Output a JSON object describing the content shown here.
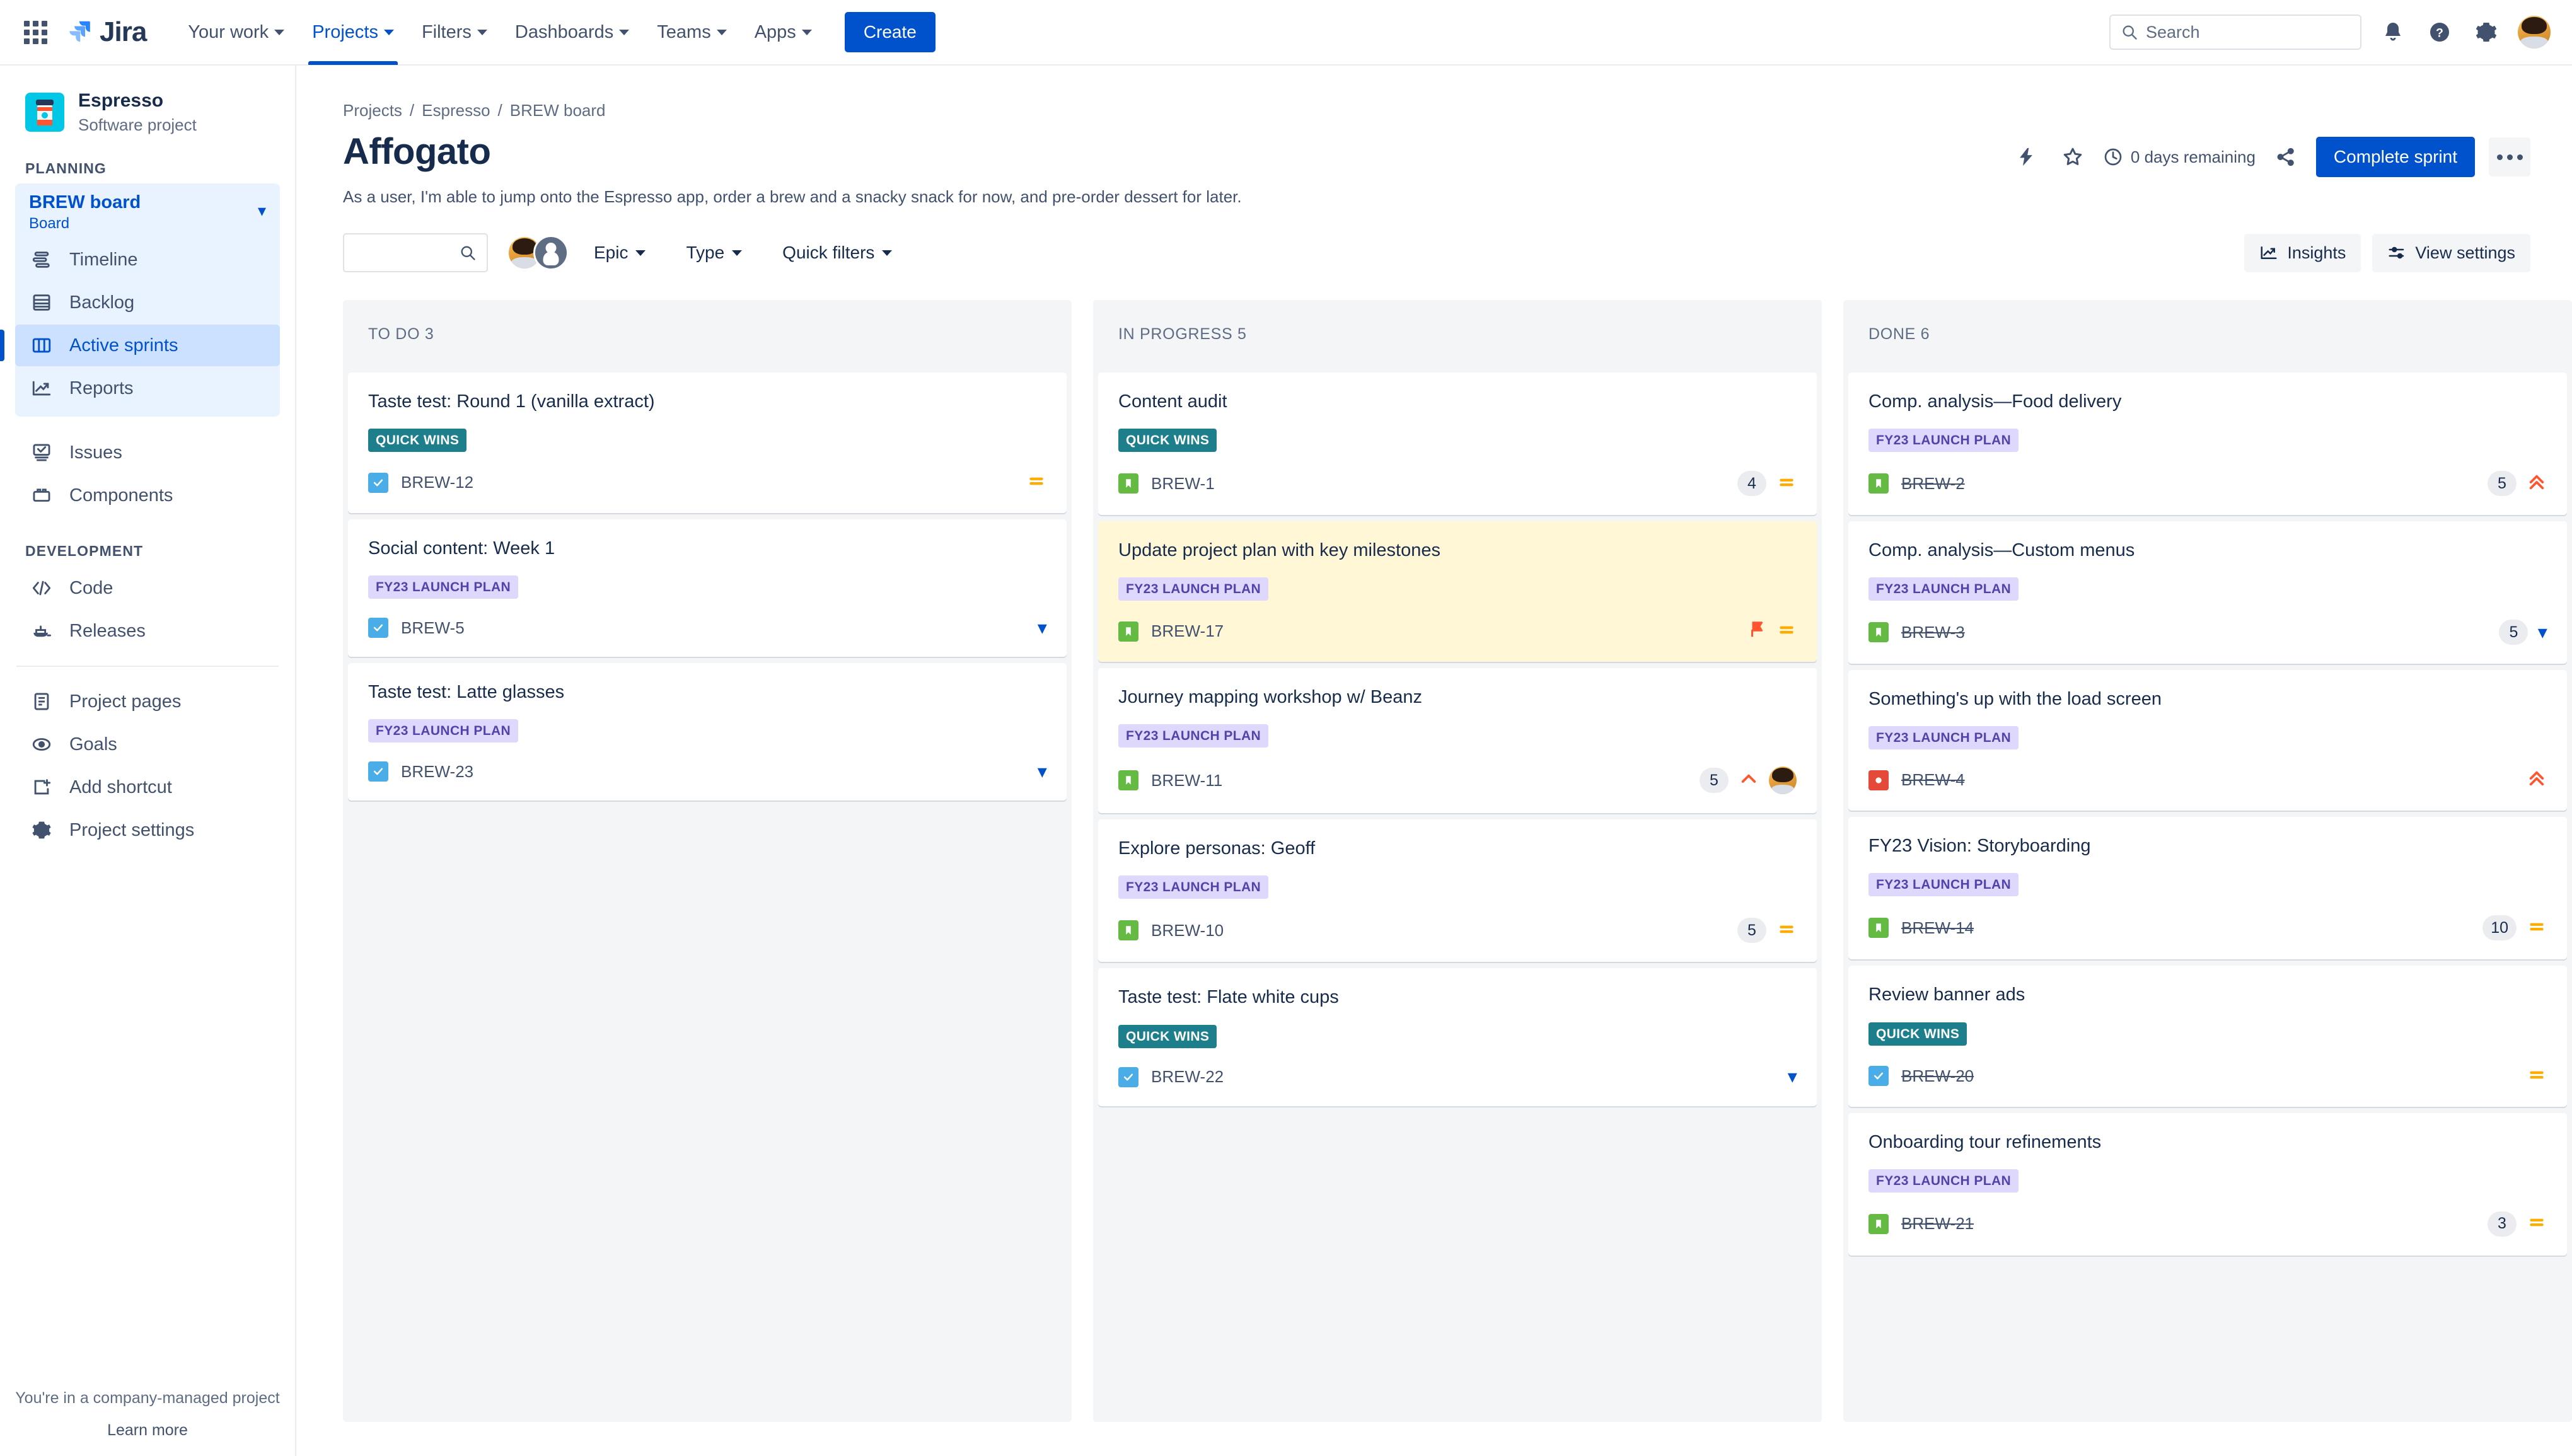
{
  "topnav": {
    "apps_icon": "apps-grid-icon",
    "brand": "Jira",
    "items": [
      {
        "label": "Your work",
        "icon": "chevron-down-icon",
        "active": false
      },
      {
        "label": "Projects",
        "icon": "chevron-down-icon",
        "active": true
      },
      {
        "label": "Filters",
        "icon": "chevron-down-icon",
        "active": false
      },
      {
        "label": "Dashboards",
        "icon": "chevron-down-icon",
        "active": false
      },
      {
        "label": "Teams",
        "icon": "chevron-down-icon",
        "active": false
      },
      {
        "label": "Apps",
        "icon": "chevron-down-icon",
        "active": false
      }
    ],
    "create_label": "Create",
    "search_placeholder": "Search",
    "search_value": "",
    "icons": [
      "search-icon",
      "notifications-bell-icon",
      "help-question-icon",
      "settings-gear-icon",
      "user-avatar"
    ]
  },
  "sidebar": {
    "project_name": "Espresso",
    "project_type": "Software project",
    "project_icon": "coffee-cup-icon",
    "planning_label": "PLANNING",
    "board_name": "BREW board",
    "board_sub": "Board",
    "planning_items": [
      {
        "label": "Timeline",
        "icon": "timeline-icon",
        "selected": false
      },
      {
        "label": "Backlog",
        "icon": "backlog-icon",
        "selected": false
      },
      {
        "label": "Active sprints",
        "icon": "board-columns-icon",
        "selected": true
      },
      {
        "label": "Reports",
        "icon": "reports-chart-icon",
        "selected": false
      }
    ],
    "other_items": [
      {
        "label": "Issues",
        "icon": "issues-icon",
        "selected": false
      },
      {
        "label": "Components",
        "icon": "components-icon",
        "selected": false
      }
    ],
    "development_label": "DEVELOPMENT",
    "development_items": [
      {
        "label": "Code",
        "icon": "code-brackets-icon",
        "selected": false
      },
      {
        "label": "Releases",
        "icon": "releases-ship-icon",
        "selected": false
      }
    ],
    "footer_items": [
      {
        "label": "Project pages",
        "icon": "page-document-icon",
        "selected": false
      },
      {
        "label": "Goals",
        "icon": "goals-eye-icon",
        "selected": false
      },
      {
        "label": "Add shortcut",
        "icon": "add-shortcut-icon",
        "selected": false
      },
      {
        "label": "Project settings",
        "icon": "settings-gear-icon",
        "selected": false
      }
    ],
    "footer_note": "You're in a company-managed project",
    "footer_link": "Learn more"
  },
  "header": {
    "breadcrumbs": [
      "Projects",
      "Espresso",
      "BREW board"
    ],
    "title": "Affogato",
    "sprint_goal": "As a user, I'm able to jump onto the Espresso app, order a brew and a snacky snack for now, and pre-order dessert for later.",
    "days_remaining": "0 days remaining",
    "complete_sprint_label": "Complete sprint",
    "action_icons": [
      "lightning-bolt-icon",
      "star-outline-icon",
      "clock-icon",
      "share-icon",
      "more-actions-icon"
    ]
  },
  "toolbar": {
    "search_value": "",
    "search_placeholder": "",
    "search_icon": "search-icon",
    "avatars": [
      "user-avatar",
      "unassigned-avatar"
    ],
    "filters": [
      {
        "label": "Epic",
        "icon": "chevron-down-icon"
      },
      {
        "label": "Type",
        "icon": "chevron-down-icon"
      },
      {
        "label": "Quick filters",
        "icon": "chevron-down-icon"
      }
    ],
    "insights_label": "Insights",
    "insights_icon": "insights-chart-icon",
    "view_settings_label": "View settings",
    "view_settings_icon": "sliders-icon"
  },
  "board": {
    "columns": [
      {
        "name": "TO DO",
        "count": "3",
        "header": "TO DO 3",
        "cards": [
          {
            "title": "Taste test: Round 1 (vanilla extract)",
            "epic": "QUICK WINS",
            "epic_style": "quick",
            "key": "BREW-12",
            "type": "task",
            "type_icon": "task-checkbox-icon",
            "points": "",
            "done": false,
            "priority": "medium",
            "priority_icon": "priority-medium-icon",
            "flagged": false,
            "assignee": false
          },
          {
            "title": "Social content: Week 1",
            "epic": "FY23 LAUNCH PLAN",
            "epic_style": "fy23",
            "key": "BREW-5",
            "type": "task",
            "type_icon": "task-checkbox-icon",
            "points": "",
            "done": false,
            "priority": "low",
            "priority_icon": "priority-low-icon",
            "flagged": false,
            "assignee": false
          },
          {
            "title": "Taste test: Latte glasses",
            "epic": "FY23 LAUNCH PLAN",
            "epic_style": "fy23",
            "key": "BREW-23",
            "type": "task",
            "type_icon": "task-checkbox-icon",
            "points": "",
            "done": false,
            "priority": "low",
            "priority_icon": "priority-low-icon",
            "flagged": false,
            "assignee": false
          }
        ]
      },
      {
        "name": "IN PROGRESS",
        "count": "5",
        "header": "IN PROGRESS 5",
        "cards": [
          {
            "title": "Content audit",
            "epic": "QUICK WINS",
            "epic_style": "quick",
            "key": "BREW-1",
            "type": "story",
            "type_icon": "story-bookmark-icon",
            "points": "4",
            "done": false,
            "priority": "medium",
            "priority_icon": "priority-medium-icon",
            "flagged": false,
            "assignee": false
          },
          {
            "title": "Update project plan with key milestones",
            "epic": "FY23 LAUNCH PLAN",
            "epic_style": "fy23",
            "key": "BREW-17",
            "type": "story",
            "type_icon": "story-bookmark-icon",
            "points": "",
            "done": false,
            "priority": "medium",
            "priority_icon": "priority-medium-icon",
            "flagged": true,
            "assignee": false
          },
          {
            "title": "Journey mapping workshop w/ Beanz",
            "epic": "FY23 LAUNCH PLAN",
            "epic_style": "fy23",
            "key": "BREW-11",
            "type": "story",
            "type_icon": "story-bookmark-icon",
            "points": "5",
            "done": false,
            "priority": "high",
            "priority_icon": "priority-high-icon",
            "flagged": false,
            "assignee": true
          },
          {
            "title": "Explore personas: Geoff",
            "epic": "FY23 LAUNCH PLAN",
            "epic_style": "fy23",
            "key": "BREW-10",
            "type": "story",
            "type_icon": "story-bookmark-icon",
            "points": "5",
            "done": false,
            "priority": "medium",
            "priority_icon": "priority-medium-icon",
            "flagged": false,
            "assignee": false
          },
          {
            "title": "Taste test: Flate white cups",
            "epic": "QUICK WINS",
            "epic_style": "quick",
            "key": "BREW-22",
            "type": "task",
            "type_icon": "task-checkbox-icon",
            "points": "",
            "done": false,
            "priority": "low",
            "priority_icon": "priority-low-icon",
            "flagged": false,
            "assignee": false
          }
        ]
      },
      {
        "name": "DONE",
        "count": "6",
        "header": "DONE 6",
        "cards": [
          {
            "title": "Comp. analysis—Food delivery",
            "epic": "FY23 LAUNCH PLAN",
            "epic_style": "fy23",
            "key": "BREW-2",
            "type": "story",
            "type_icon": "story-bookmark-icon",
            "points": "5",
            "done": true,
            "priority": "highest",
            "priority_icon": "priority-highest-icon",
            "flagged": false,
            "assignee": false
          },
          {
            "title": "Comp. analysis—Custom menus",
            "epic": "FY23 LAUNCH PLAN",
            "epic_style": "fy23",
            "key": "BREW-3",
            "type": "story",
            "type_icon": "story-bookmark-icon",
            "points": "5",
            "done": true,
            "priority": "low",
            "priority_icon": "priority-low-icon",
            "flagged": false,
            "assignee": false
          },
          {
            "title": "Something's up with the load screen",
            "epic": "FY23 LAUNCH PLAN",
            "epic_style": "fy23",
            "key": "BREW-4",
            "type": "bug",
            "type_icon": "bug-icon",
            "points": "",
            "done": true,
            "priority": "highest",
            "priority_icon": "priority-highest-icon",
            "flagged": false,
            "assignee": false
          },
          {
            "title": "FY23 Vision: Storyboarding",
            "epic": "FY23 LAUNCH PLAN",
            "epic_style": "fy23",
            "key": "BREW-14",
            "type": "story",
            "type_icon": "story-bookmark-icon",
            "points": "10",
            "done": true,
            "priority": "medium",
            "priority_icon": "priority-medium-icon",
            "flagged": false,
            "assignee": false
          },
          {
            "title": "Review banner ads",
            "epic": "QUICK WINS",
            "epic_style": "quick",
            "key": "BREW-20",
            "type": "task",
            "type_icon": "task-checkbox-icon",
            "points": "",
            "done": true,
            "priority": "medium",
            "priority_icon": "priority-medium-icon",
            "flagged": false,
            "assignee": false
          },
          {
            "title": "Onboarding tour refinements",
            "epic": "FY23 LAUNCH PLAN",
            "epic_style": "fy23",
            "key": "BREW-21",
            "type": "story",
            "type_icon": "story-bookmark-icon",
            "points": "3",
            "done": true,
            "priority": "medium",
            "priority_icon": "priority-medium-icon",
            "flagged": false,
            "assignee": false
          }
        ]
      }
    ]
  },
  "colors": {
    "brand_blue": "#0052CC",
    "epic_quick_wins": "#1D7F8C",
    "epic_fy23": "#DFD8FD",
    "epic_fy23_text": "#5243AA",
    "task_blue": "#4BADE8",
    "story_green": "#65BA43",
    "bug_red": "#E5493A",
    "priority_medium": "#FFAB00",
    "priority_high": "#FF5630",
    "priority_low": "#0052CC",
    "flag_red": "#FF5630",
    "card_flagged_bg": "#FFF7D6",
    "column_bg": "#F4F5F7"
  }
}
